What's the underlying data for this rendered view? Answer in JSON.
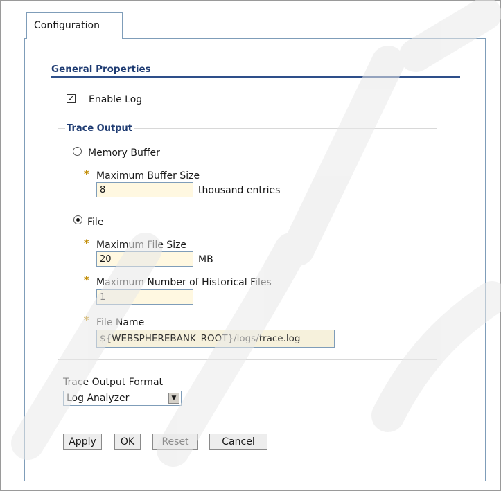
{
  "tab": {
    "label": "Configuration"
  },
  "general": {
    "title": "General Properties",
    "enable_log": {
      "label": "Enable Log",
      "checked": true
    }
  },
  "trace_output": {
    "legend": "Trace Output",
    "memory_buffer": {
      "label": "Memory Buffer",
      "selected": false,
      "max_buffer_size": {
        "label": "Maximum Buffer Size",
        "value": "8",
        "unit": "thousand entries"
      }
    },
    "file": {
      "label": "File",
      "selected": true,
      "max_file_size": {
        "label": "Maximum File Size",
        "value": "20",
        "unit": "MB"
      },
      "max_historical_files": {
        "label": "Maximum Number of Historical Files",
        "value": "1"
      },
      "file_name": {
        "label": "File Name",
        "value": "${WEBSPHEREBANK_ROOT}/logs/trace.log"
      }
    }
  },
  "format": {
    "label": "Trace Output Format",
    "selected": "Log Analyzer"
  },
  "buttons": {
    "apply": "Apply",
    "ok": "OK",
    "reset": "Reset",
    "cancel": "Cancel"
  },
  "required_marker": "*",
  "colors": {
    "accent": "#1e3b72",
    "border": "#7f9db9",
    "input_bg": "#fff8e1"
  }
}
